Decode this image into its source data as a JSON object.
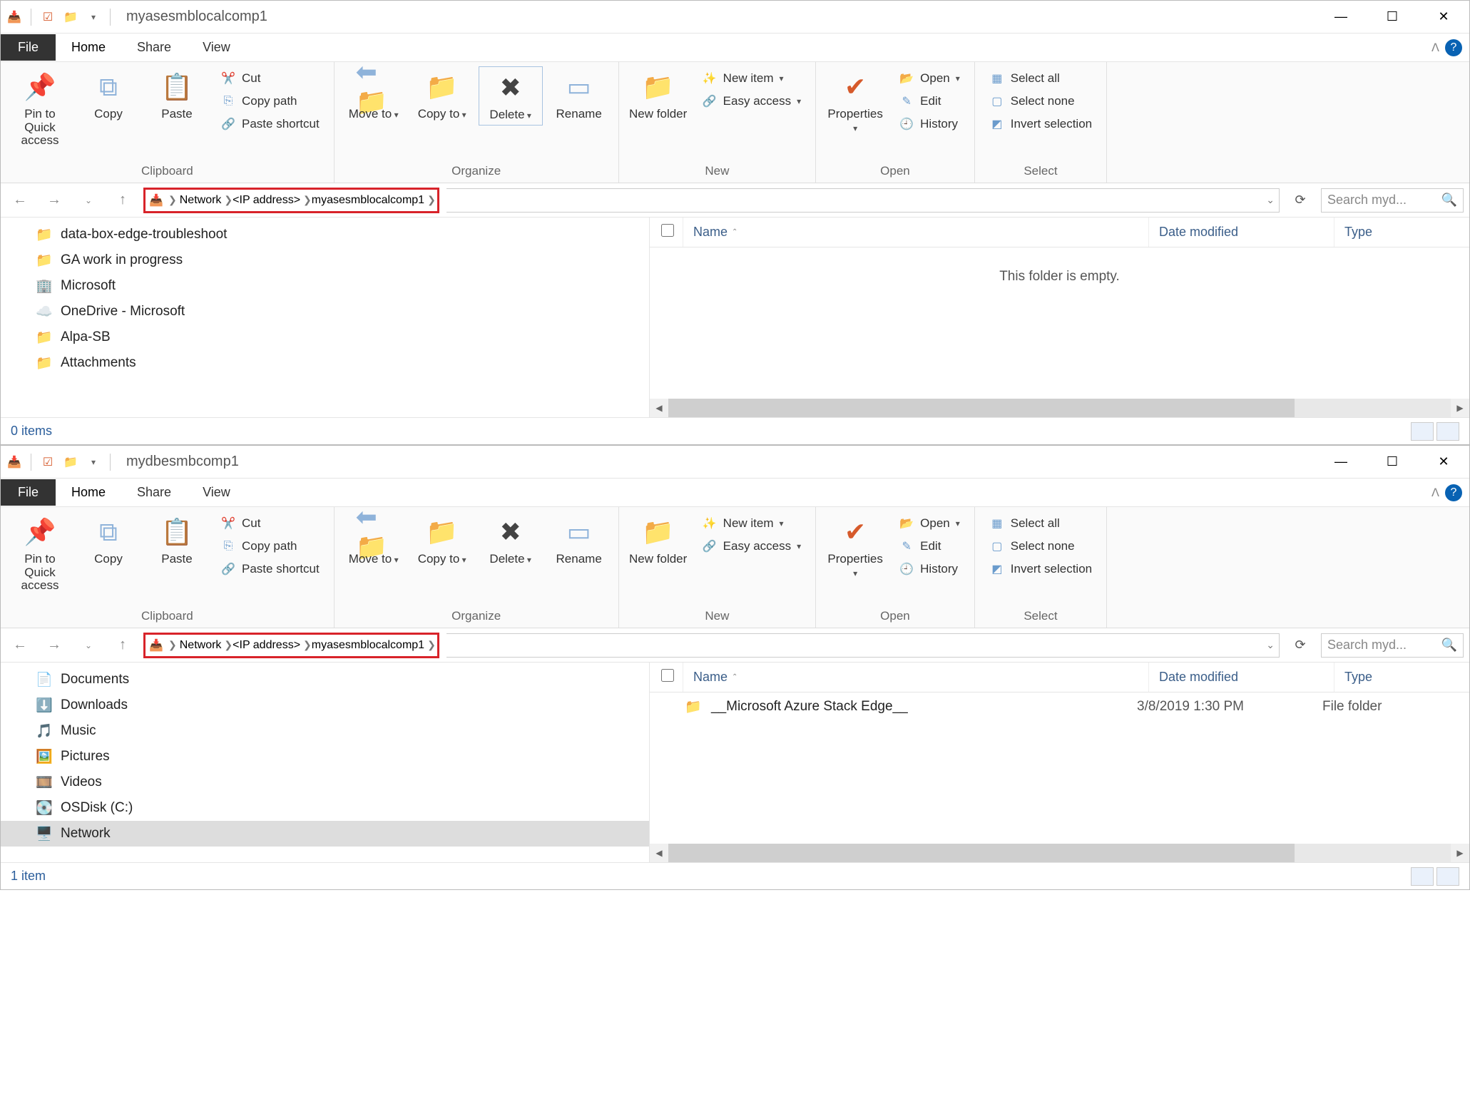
{
  "windows": [
    {
      "title": "myasesmblocalcomp1",
      "tabs": {
        "file": "File",
        "home": "Home",
        "share": "Share",
        "view": "View"
      },
      "ribbon": {
        "clipboard": {
          "label": "Clipboard",
          "pin": "Pin to Quick access",
          "copy": "Copy",
          "paste": "Paste",
          "cut": "Cut",
          "copypath": "Copy path",
          "pasteshort": "Paste shortcut"
        },
        "organize": {
          "label": "Organize",
          "moveto": "Move to",
          "copyto": "Copy to",
          "delete": "Delete",
          "rename": "Rename"
        },
        "new": {
          "label": "New",
          "newfolder": "New folder",
          "newitem": "New item",
          "easyaccess": "Easy access"
        },
        "open": {
          "label": "Open",
          "properties": "Properties",
          "open": "Open",
          "edit": "Edit",
          "history": "History"
        },
        "select": {
          "label": "Select",
          "selectall": "Select all",
          "selectnone": "Select none",
          "invert": "Invert selection"
        }
      },
      "breadcrumb": [
        "Network",
        "<IP address>",
        "myasesmblocalcomp1"
      ],
      "search_placeholder": "Search myd...",
      "nav_items": [
        {
          "label": "data-box-edge-troubleshoot",
          "icon": "folder"
        },
        {
          "label": "GA work in progress",
          "icon": "folder"
        },
        {
          "label": "Microsoft",
          "icon": "building"
        },
        {
          "label": "OneDrive - Microsoft",
          "icon": "cloud"
        },
        {
          "label": "Alpa-SB",
          "icon": "folder"
        },
        {
          "label": "Attachments",
          "icon": "folder"
        }
      ],
      "columns": {
        "name": "Name",
        "date": "Date modified",
        "type": "Type"
      },
      "empty_text": "This folder is empty.",
      "rows": [],
      "status": "0 items"
    },
    {
      "title": "mydbesmbcomp1",
      "tabs": {
        "file": "File",
        "home": "Home",
        "share": "Share",
        "view": "View"
      },
      "ribbon": {
        "clipboard": {
          "label": "Clipboard",
          "pin": "Pin to Quick access",
          "copy": "Copy",
          "paste": "Paste",
          "cut": "Cut",
          "copypath": "Copy path",
          "pasteshort": "Paste shortcut"
        },
        "organize": {
          "label": "Organize",
          "moveto": "Move to",
          "copyto": "Copy to",
          "delete": "Delete",
          "rename": "Rename"
        },
        "new": {
          "label": "New",
          "newfolder": "New folder",
          "newitem": "New item",
          "easyaccess": "Easy access"
        },
        "open": {
          "label": "Open",
          "properties": "Properties",
          "open": "Open",
          "edit": "Edit",
          "history": "History"
        },
        "select": {
          "label": "Select",
          "selectall": "Select all",
          "selectnone": "Select none",
          "invert": "Invert selection"
        }
      },
      "breadcrumb": [
        "Network",
        "<IP address>",
        "myasesmblocalcomp1"
      ],
      "search_placeholder": "Search myd...",
      "nav_items": [
        {
          "label": "Documents",
          "icon": "doc"
        },
        {
          "label": "Downloads",
          "icon": "download"
        },
        {
          "label": "Music",
          "icon": "music"
        },
        {
          "label": "Pictures",
          "icon": "picture"
        },
        {
          "label": "Videos",
          "icon": "video"
        },
        {
          "label": "OSDisk (C:)",
          "icon": "disk"
        },
        {
          "label": "Network",
          "icon": "network",
          "selected": true
        }
      ],
      "columns": {
        "name": "Name",
        "date": "Date modified",
        "type": "Type"
      },
      "empty_text": "",
      "rows": [
        {
          "name": "__Microsoft Azure Stack Edge__",
          "date": "3/8/2019 1:30 PM",
          "type": "File folder"
        }
      ],
      "status": "1 item"
    }
  ]
}
